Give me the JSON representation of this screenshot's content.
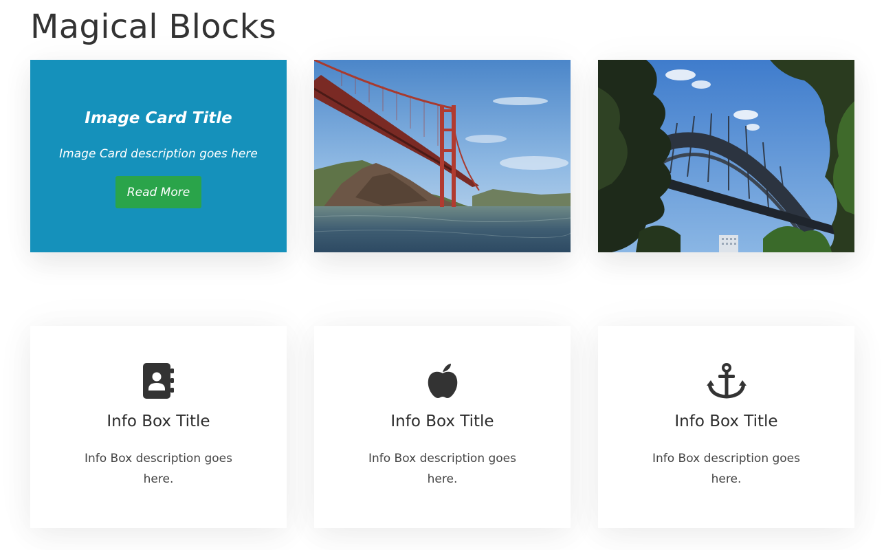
{
  "page": {
    "title": "Magical Blocks"
  },
  "image_cards": [
    {
      "title": "Image Card Title",
      "description": "Image Card description goes here",
      "button_label": "Read More",
      "background_color": "#1591bb",
      "button_color": "#2aa44a"
    },
    {
      "image": "golden-gate-bridge-photo"
    },
    {
      "image": "sydney-harbour-bridge-photo"
    }
  ],
  "info_boxes": [
    {
      "icon": "address-book-icon",
      "title": "Info Box Title",
      "description": "Info Box description goes here."
    },
    {
      "icon": "apple-icon",
      "title": "Info Box Title",
      "description": "Info Box description goes here."
    },
    {
      "icon": "anchor-icon",
      "title": "Info Box Title",
      "description": "Info Box description goes here."
    }
  ]
}
